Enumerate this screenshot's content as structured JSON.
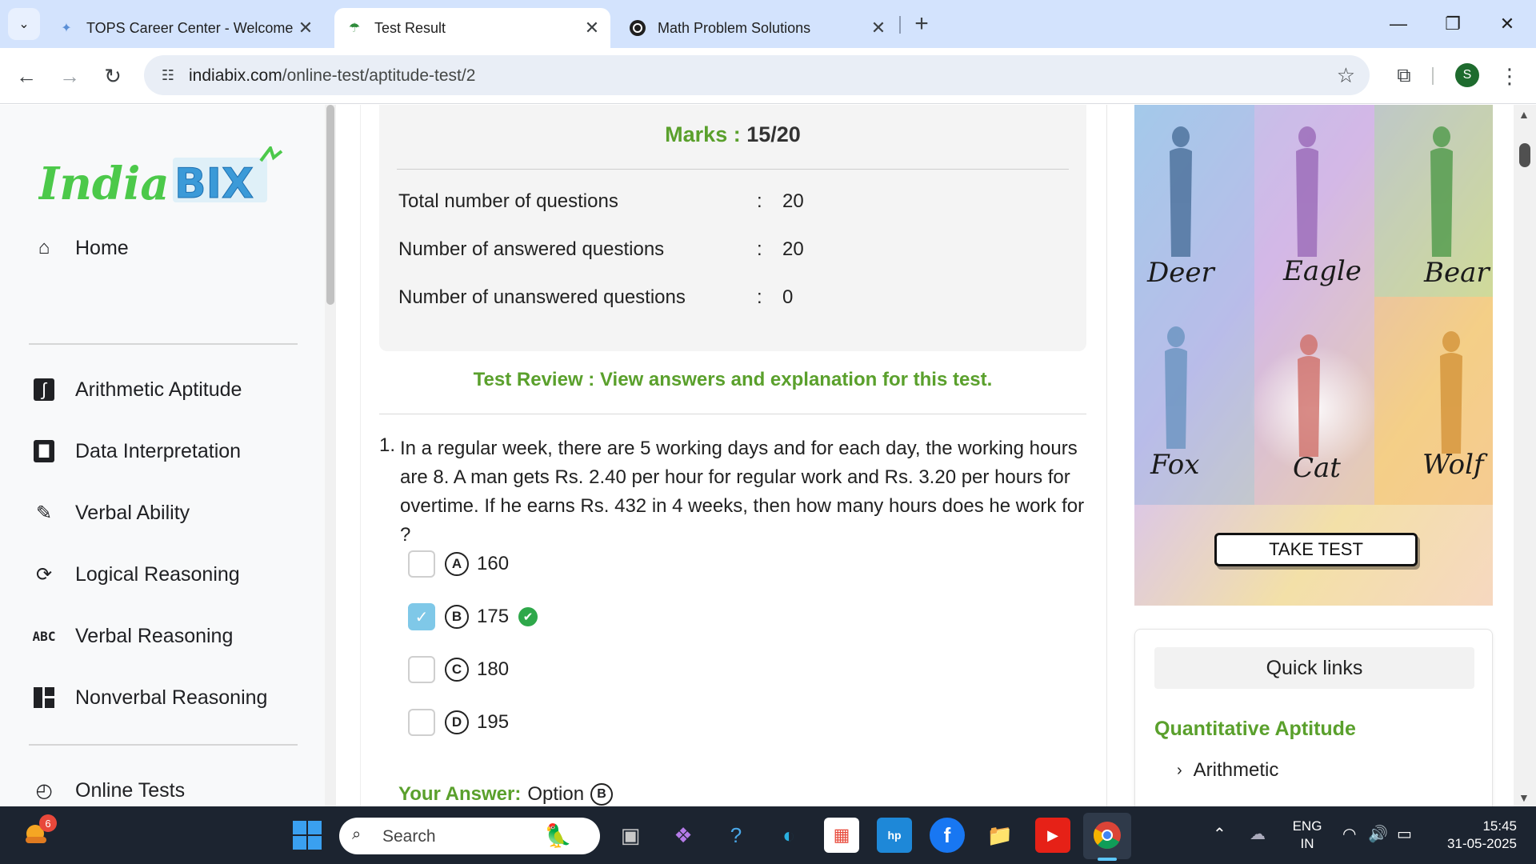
{
  "browser": {
    "tabs": [
      {
        "title": "TOPS Career Center - Welcome",
        "icon": "tops-logo-icon"
      },
      {
        "title": "Test Result",
        "icon": "indiabix-umbrella-icon"
      },
      {
        "title": "Math Problem Solutions",
        "icon": "chatgpt-icon"
      }
    ],
    "url_domain": "indiabix.com",
    "url_path": "/online-test/aptitude-test/2",
    "profile_initial": "S"
  },
  "sidebar": {
    "logo_text": "IndiaBIX",
    "items": [
      {
        "label": "Home",
        "icon": "home-icon"
      },
      {
        "label": "Arithmetic Aptitude",
        "icon": "integral-icon"
      },
      {
        "label": "Data Interpretation",
        "icon": "bar-chart-icon"
      },
      {
        "label": "Verbal Ability",
        "icon": "edit-note-icon"
      },
      {
        "label": "Logical Reasoning",
        "icon": "cycle-icon"
      },
      {
        "label": "Verbal Reasoning",
        "icon": "abc-icon",
        "icon_text": "ABC"
      },
      {
        "label": "Nonverbal Reasoning",
        "icon": "dashboard-icon"
      },
      {
        "label": "Online Tests",
        "icon": "clock-icon"
      }
    ]
  },
  "result": {
    "marks_label": "Marks :",
    "marks_value": "15/20",
    "stats": [
      {
        "label": "Total number of questions",
        "value": "20"
      },
      {
        "label": "Number of answered questions",
        "value": "20"
      },
      {
        "label": "Number of unanswered questions",
        "value": "0"
      }
    ],
    "colon": ":",
    "review_text": "Test Review : View answers and explanation for this test."
  },
  "question": {
    "number": "1.",
    "text": "In a regular week, there are 5 working days and for each day, the working hours are 8. A man gets Rs. 2.40 per hour for regular work and Rs. 3.20 per hours for overtime. If he earns Rs. 432 in 4 weeks, then how many hours does he work for ?",
    "options": [
      {
        "letter": "A",
        "value": "160",
        "checked": false,
        "correct": false
      },
      {
        "letter": "B",
        "value": "175",
        "checked": true,
        "correct": true
      },
      {
        "letter": "C",
        "value": "180",
        "checked": false,
        "correct": false
      },
      {
        "letter": "D",
        "value": "195",
        "checked": false,
        "correct": false
      }
    ],
    "your_answer_label": "Your Answer:",
    "your_answer_value": "Option",
    "your_answer_letter": "B"
  },
  "ad": {
    "labels": [
      "Deer",
      "Eagle",
      "Bear",
      "Fox",
      "Cat",
      "Wolf"
    ],
    "button": "TAKE TEST"
  },
  "quick_links": {
    "title": "Quick links",
    "section": "Quantitative Aptitude",
    "items": [
      "Arithmetic"
    ]
  },
  "taskbar": {
    "weather_badge": "6",
    "search_placeholder": "Search",
    "lang_line1": "ENG",
    "lang_line2": "IN",
    "time": "15:45",
    "date": "31-05-2025"
  },
  "colors": {
    "accent_green": "#5aa02c",
    "check_blue": "#7fc8e8",
    "correct_green": "#2ea84a",
    "tab_bar": "#d3e3fd"
  }
}
